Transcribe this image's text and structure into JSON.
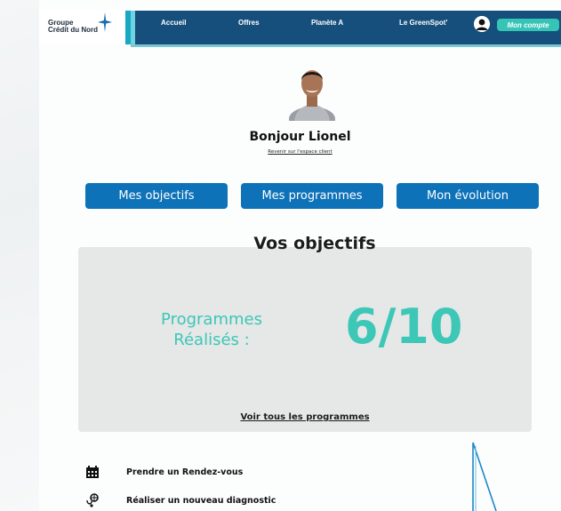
{
  "brand": {
    "logo_line1": "Groupe",
    "logo_line2": "Crédit du Nord",
    "accent_color": "#0e72b9",
    "teal_color": "#3cc7b7"
  },
  "nav": {
    "items": [
      {
        "label": "Accueil"
      },
      {
        "label": "Offres"
      },
      {
        "label": "Planète A"
      },
      {
        "label": "Le GreenSpot'"
      }
    ],
    "account_label": "Mon compte"
  },
  "profile": {
    "greeting": "Bonjour Lionel",
    "back_link": "Revenir sur l'espace client"
  },
  "tabs": [
    {
      "label": "Mes objectifs"
    },
    {
      "label": "Mes programmes"
    },
    {
      "label": "Mon évolution"
    }
  ],
  "objectives": {
    "title": "Vos objectifs",
    "label_line1": "Programmes",
    "label_line2": "Réalisés :",
    "value": "6/10",
    "see_all": "Voir tous les programmes"
  },
  "actions": [
    {
      "label": "Prendre un Rendez-vous",
      "icon": "calendar-icon"
    },
    {
      "label": "Réaliser un nouveau diagnostic",
      "icon": "diagnostic-icon"
    }
  ]
}
